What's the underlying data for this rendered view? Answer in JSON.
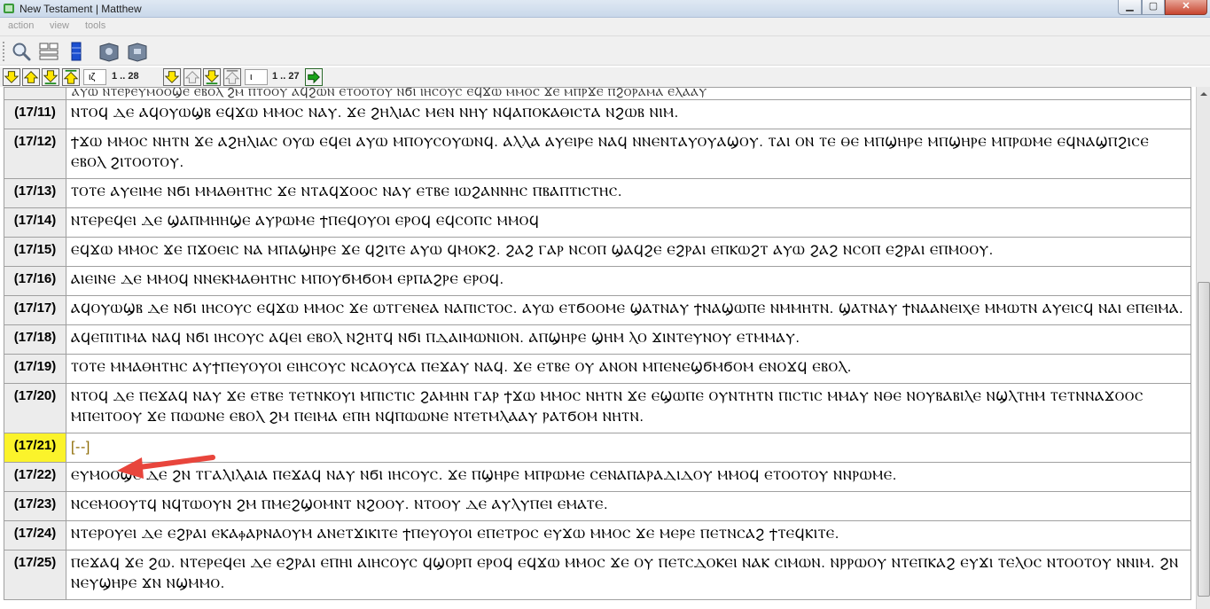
{
  "window": {
    "title": "New Testament | Matthew",
    "controls": {
      "minimize": "▁",
      "maximize": "▢",
      "close": "✕"
    }
  },
  "menu": [
    "action",
    "view",
    "tools"
  ],
  "toolbar": {
    "buttons": [
      "search-icon",
      "layout-icon",
      "columns-icon",
      "book-icon",
      "book-alt-icon"
    ]
  },
  "nav": {
    "chapter_value": "ιζ",
    "chapter_range": "1 .. 28",
    "verse_value": "ι",
    "verse_range": "1 .. 27",
    "colors": {
      "yellow_btn": "#ffe600",
      "green_go": "#1aa31a"
    }
  },
  "verses": [
    {
      "ref": "",
      "text": "ⲀⲨⲰ ⲚⲦⲈⲢⲈⲨⲘⲞⲞϢⲈ ⲈⲂⲞⲖ ϨⲘ ⲠⲦⲞⲞⲨ ⲀϤϨⲰⲚ ⲈⲦⲞⲞⲦⲞⲨ ⲚϬⲒ ⲒⲎⲤⲞⲨⲤ ⲈϤϪⲰ ⲘⲘⲞⲤ ϪⲈ ⲘⲠⲢϪⲈ ⲠϨⲞⲢⲀⲘⲀ ⲈⲖⲀⲀⲨ"
    },
    {
      "ref": "(17/11)",
      "text": "ⲚⲦⲞϤ ⲆⲈ ⲀϤⲞⲨⲰϢⲂ ⲈϤϪⲰ ⲘⲘⲞⲤ ⲚⲀⲨ. ϪⲈ ϨⲎⲖⲒⲀⲤ ⲘⲈⲚ ⲚⲎⲨ ⲚϤⲀⲠⲞⲔⲀⲐⲒⲤⲦⲀ ⲚϨⲰⲂ ⲚⲒⲘ."
    },
    {
      "ref": "(17/12)",
      "text": "ϮϪⲰ ⲘⲘⲞⲤ ⲚⲎⲦⲚ ϪⲈ ⲀϨⲎⲖⲒⲀⲤ ⲞⲨⲰ ⲈϤⲈⲒ ⲀⲨⲰ ⲘⲠⲞⲨⲤⲞⲨⲰⲚϤ. ⲀⲖⲖⲀ ⲀⲨⲈⲒⲢⲈ ⲚⲀϤ ⲚⲚⲈⲚⲦⲀⲨⲞⲨⲀϢⲞⲨ. ⲦⲀⲒ ⲞⲚ ⲦⲈ ⲐⲈ ⲘⲠϢⲎⲢⲈ ⲘⲠϢⲎⲢⲈ ⲘⲠⲢⲰⲘⲈ ⲈϤⲚⲀϢⲠϨⲒⲤⲈ ⲈⲂⲞⲖ ϨⲒⲦⲞⲞⲦⲞⲨ."
    },
    {
      "ref": "(17/13)",
      "text": "ⲦⲞⲦⲈ ⲀⲨⲈⲒⲘⲈ ⲚϬⲒ ⲘⲘⲀⲐⲎⲦⲎⲤ ϪⲈ ⲚⲦⲀϤϪⲞⲞⲤ ⲚⲀⲨ ⲈⲦⲂⲈ ⲒⲰϨⲀⲚⲚⲎⲤ ⲠⲂⲀⲠⲦⲒⲤⲦⲎⲤ."
    },
    {
      "ref": "(17/14)",
      "text": "ⲚⲦⲈⲢⲈϤⲈⲒ ⲆⲈ ϢⲀⲠⲘⲎⲎϢⲈ ⲀⲨⲢⲰⲘⲈ ϮⲠⲈϤⲞⲨⲞⲒ ⲈⲢⲞϤ ⲈϤⲤⲞⲠⲤ ⲘⲘⲞϤ"
    },
    {
      "ref": "(17/15)",
      "text": "ⲈϤϪⲰ ⲘⲘⲞⲤ ϪⲈ ⲠϪⲞⲈⲒⲤ ⲚⲀ ⲘⲠⲀϢⲎⲢⲈ ϪⲈ ϤϨⲒⲦⲈ ⲀⲨⲰ ϤⲘⲞⲔϨ. ϨⲀϨ ⲄⲀⲢ ⲚⲤⲞⲠ ϢⲀϤϨⲈ ⲈϨⲢⲀⲒ ⲈⲠⲔⲰϨⲦ ⲀⲨⲰ ϨⲀϨ ⲚⲤⲞⲠ ⲈϨⲢⲀⲒ ⲈⲠⲘⲞⲞⲨ."
    },
    {
      "ref": "(17/16)",
      "text": "ⲀⲒⲈⲒⲚⲈ ⲆⲈ ⲘⲘⲞϤ ⲚⲚⲈⲔⲘⲀⲐⲎⲦⲎⲤ ⲘⲠⲞⲨϬⲘϬⲞⲘ ⲈⲢⲠⲀϨⲢⲈ ⲈⲢⲞϤ."
    },
    {
      "ref": "(17/17)",
      "text": "ⲀϤⲞⲨⲰϢⲂ ⲆⲈ ⲚϬⲒ ⲒⲎⲤⲞⲨⲤ ⲈϤϪⲰ ⲘⲘⲞⲤ ϪⲈ ⲰⲦⲄⲈⲚⲈⲀ ⲚⲀⲠⲒⲤⲦⲞⲤ. ⲀⲨⲰ ⲈⲦϬⲞⲞⲘⲈ ϢⲀⲦⲚⲀⲨ ϮⲚⲀϢⲰⲠⲈ ⲚⲘⲘⲎⲦⲚ. ϢⲀⲦⲚⲀⲨ ϮⲚⲀⲀⲚⲈⲒⲬⲈ ⲘⲘⲰⲦⲚ ⲀⲨⲈⲒⲤϤ ⲚⲀⲒ ⲈⲠⲈⲒⲘⲀ."
    },
    {
      "ref": "(17/18)",
      "text": "ⲀϤⲈⲠⲒⲦⲒⲘⲀ ⲚⲀϤ ⲚϬⲒ ⲒⲎⲤⲞⲨⲤ ⲀϤⲈⲒ ⲈⲂⲞⲖ ⲚϨⲎⲦϤ ⲚϬⲒ ⲠⲆⲀⲒⲘⲰⲚⲒⲞⲚ. ⲀⲠϢⲎⲢⲈ ϢⲎⲘ ⲖⲞ ϪⲒⲚⲦⲈⲨⲚⲞⲨ ⲈⲦⲘⲘⲀⲨ."
    },
    {
      "ref": "(17/19)",
      "text": "ⲦⲞⲦⲈ ⲘⲘⲀⲐⲎⲦⲎⲤ ⲀⲨϮⲠⲈⲨⲞⲨⲞⲒ ⲈⲒⲎⲤⲞⲨⲤ ⲚⲤⲀⲞⲨⲤⲀ ⲠⲈϪⲀⲨ ⲚⲀϤ. ϪⲈ ⲈⲦⲂⲈ ⲞⲨ ⲀⲚⲞⲚ ⲘⲠⲈⲚⲈϢϬⲘϬⲞⲘ ⲈⲚⲞϪϤ ⲈⲂⲞⲖ."
    },
    {
      "ref": "(17/20)",
      "text": "ⲚⲦⲞϤ ⲆⲈ ⲠⲈϪⲀϤ ⲚⲀⲨ ϪⲈ ⲈⲦⲂⲈ ⲦⲈⲦⲚⲔⲞⲨⲒ ⲘⲠⲒⲤⲦⲒⲤ ϨⲀⲘⲎⲚ ⲄⲀⲢ ϮϪⲰ ⲘⲘⲞⲤ ⲚⲎⲦⲚ ϪⲈ ⲈϢⲰⲠⲈ ⲞⲨⲚⲦⲎⲦⲚ ⲠⲒⲤⲦⲒⲤ ⲘⲘⲀⲨ ⲚⲐⲈ ⲚⲞⲨⲂⲀⲂⲒⲖⲈ ⲚϢⲖⲦⲎⲘ ⲦⲈⲦⲚⲚⲀϪⲞⲞⲤ ⲘⲠⲈⲒⲦⲞⲞⲨ ϪⲈ ⲠⲰⲰⲚⲈ ⲈⲂⲞⲖ ϨⲘ ⲠⲈⲒⲘⲀ ⲈⲠⲎ ⲚϤⲠⲰⲰⲚⲈ ⲚⲦⲈⲦⲘⲖⲀⲀⲨ ⲢⲀⲦϬⲞⲘ ⲚⲎⲦⲚ."
    },
    {
      "ref": "(17/21)",
      "text": "[--]"
    },
    {
      "ref": "(17/22)",
      "text": "ⲈⲨⲘⲞⲞϢⲈ ⲆⲈ ϨⲚ ⲦⲄⲀⲖⲒⲖⲀⲒⲀ ⲠⲈϪⲀϤ ⲚⲀⲨ ⲚϬⲒ ⲒⲎⲤⲞⲨⲤ. ϪⲈ ⲠϢⲎⲢⲈ ⲘⲠⲢⲰⲘⲈ ⲤⲈⲚⲀⲠⲀⲢⲀⲆⲒⲆⲞⲨ ⲘⲘⲞϤ ⲈⲦⲞⲞⲦⲞⲨ ⲚⲚⲢⲰⲘⲈ."
    },
    {
      "ref": "(17/23)",
      "text": "ⲚⲤⲈⲘⲞⲞⲨⲦϤ ⲚϤⲦⲰⲞⲨⲚ ϨⲘ ⲠⲘⲈϨϢⲞⲘⲚⲦ ⲚϨⲞⲞⲨ. ⲚⲦⲞⲞⲨ ⲆⲈ ⲀⲨⲖⲨⲠⲈⲒ ⲈⲘⲀⲦⲈ."
    },
    {
      "ref": "(17/24)",
      "text": "ⲚⲦⲈⲢⲞⲨⲈⲒ ⲆⲈ ⲈϨⲢⲀⲒ ⲈⲔⲀⲫⲀⲢⲚⲀⲞⲨⲘ ⲀⲚⲈⲦϪⲒⲔⲒⲦⲈ ϮⲠⲈⲨⲞⲨⲞⲒ ⲈⲠⲈⲦⲢⲞⲤ ⲈⲨϪⲰ ⲘⲘⲞⲤ ϪⲈ ⲘⲈⲢⲈ ⲠⲈⲦⲚⲤⲀϨ ϮⲦⲈϤⲔⲒⲦⲈ."
    },
    {
      "ref": "(17/25)",
      "text": "ⲠⲈϪⲀϤ ϪⲈ ϨⲰ. ⲚⲦⲈⲢⲈϤⲈⲒ ⲆⲈ ⲈϨⲢⲀⲒ ⲈⲠⲎⲒ ⲀⲒⲎⲤⲞⲨⲤ ϤϢⲞⲢⲠ ⲈⲢⲞϤ ⲈϤϪⲰ ⲘⲘⲞⲤ ϪⲈ ⲞⲨ ⲠⲈⲦⲤⲆⲞⲔⲈⲒ ⲚⲀⲔ ⲤⲒⲘⲰⲚ. ⲚⲢⲢⲰⲞⲨ ⲚⲦⲈⲠⲔⲀϨ ⲈⲨϪⲒ ⲦⲈⲖⲞⲤ ⲚⲦⲞⲞⲦⲞⲨ ⲚⲚⲒⲘ. ϨⲚ ⲚⲈⲨϢⲎⲢⲈ ϪⲚ ⲚϢⲘⲘⲞ."
    }
  ],
  "annotation": {
    "color": "#e8453c",
    "label": "arrow-annotation"
  }
}
